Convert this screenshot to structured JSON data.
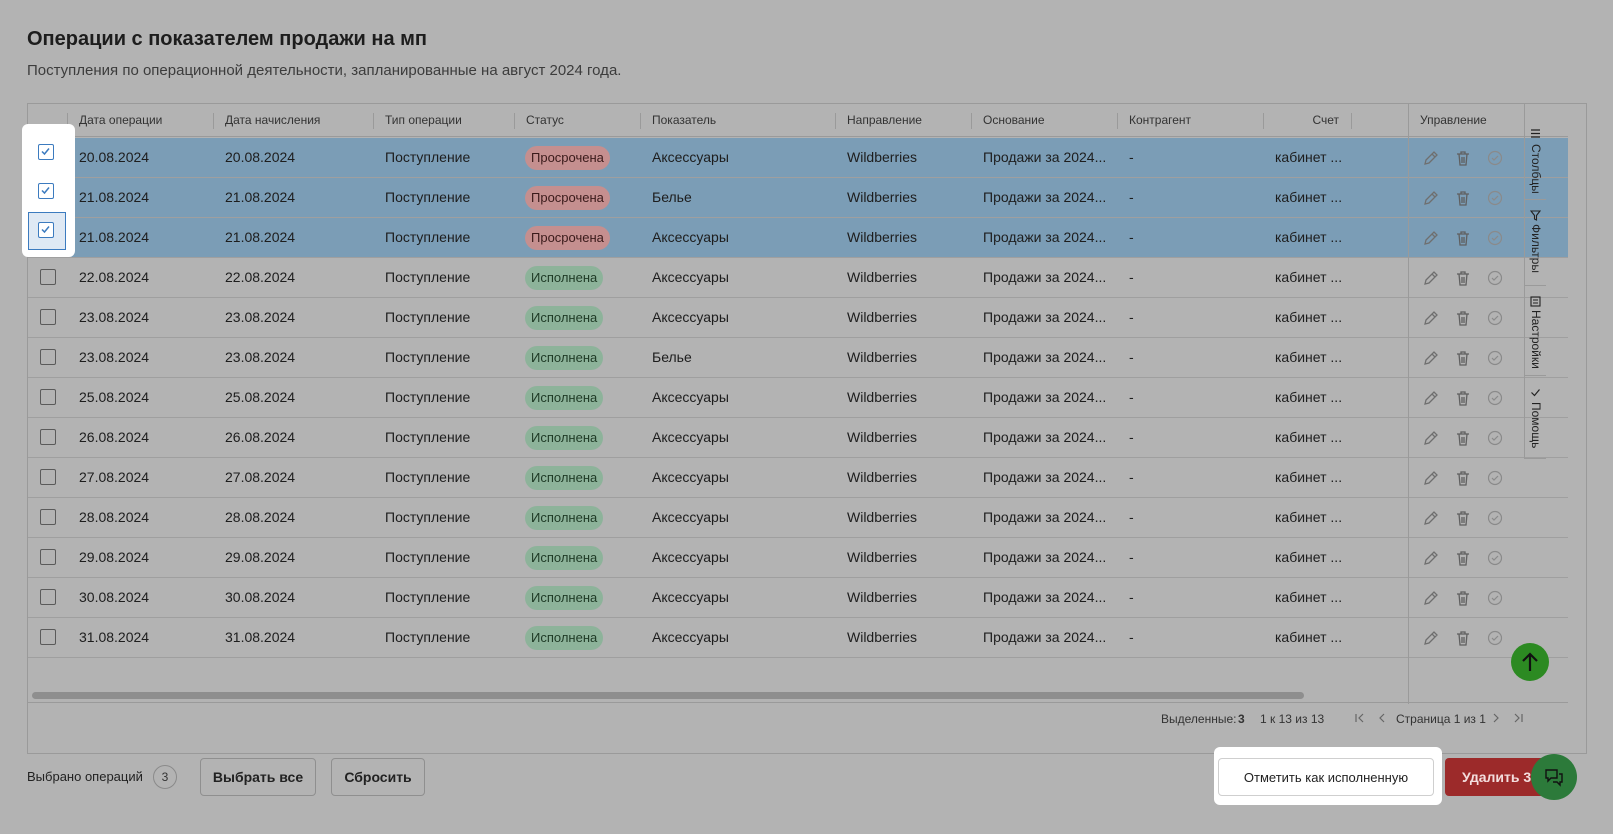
{
  "page": {
    "title": "Операции с показателем продажи на мп",
    "subtitle": "Поступления по операционной деятельности, запланированные на август 2024 года."
  },
  "table": {
    "headers": {
      "op_date": "Дата операции",
      "accrual_date": "Дата начисления",
      "op_type": "Тип операции",
      "status": "Статус",
      "indicator": "Показатель",
      "direction": "Направление",
      "basis": "Основание",
      "counterparty": "Контрагент",
      "account": "Счет",
      "manage": "Управление"
    },
    "rows": [
      {
        "op_date": "20.08.2024",
        "accrual_date": "20.08.2024",
        "op_type": "Поступление",
        "status": "Просрочена",
        "indicator": "Аксессуары",
        "direction": "Wildberries",
        "basis": "Продажи за 2024...",
        "counterparty": "-",
        "account": "кабинет ..."
      },
      {
        "op_date": "21.08.2024",
        "accrual_date": "21.08.2024",
        "op_type": "Поступление",
        "status": "Просрочена",
        "indicator": "Белье",
        "direction": "Wildberries",
        "basis": "Продажи за 2024...",
        "counterparty": "-",
        "account": "кабинет ..."
      },
      {
        "op_date": "21.08.2024",
        "accrual_date": "21.08.2024",
        "op_type": "Поступление",
        "status": "Просрочена",
        "indicator": "Аксессуары",
        "direction": "Wildberries",
        "basis": "Продажи за 2024...",
        "counterparty": "-",
        "account": "кабинет ..."
      },
      {
        "op_date": "22.08.2024",
        "accrual_date": "22.08.2024",
        "op_type": "Поступление",
        "status": "Исполнена",
        "indicator": "Аксессуары",
        "direction": "Wildberries",
        "basis": "Продажи за 2024...",
        "counterparty": "-",
        "account": "кабинет ..."
      },
      {
        "op_date": "23.08.2024",
        "accrual_date": "23.08.2024",
        "op_type": "Поступление",
        "status": "Исполнена",
        "indicator": "Аксессуары",
        "direction": "Wildberries",
        "basis": "Продажи за 2024...",
        "counterparty": "-",
        "account": "кабинет ..."
      },
      {
        "op_date": "23.08.2024",
        "accrual_date": "23.08.2024",
        "op_type": "Поступление",
        "status": "Исполнена",
        "indicator": "Белье",
        "direction": "Wildberries",
        "basis": "Продажи за 2024...",
        "counterparty": "-",
        "account": "кабинет ..."
      },
      {
        "op_date": "25.08.2024",
        "accrual_date": "25.08.2024",
        "op_type": "Поступление",
        "status": "Исполнена",
        "indicator": "Аксессуары",
        "direction": "Wildberries",
        "basis": "Продажи за 2024...",
        "counterparty": "-",
        "account": "кабинет ..."
      },
      {
        "op_date": "26.08.2024",
        "accrual_date": "26.08.2024",
        "op_type": "Поступление",
        "status": "Исполнена",
        "indicator": "Аксессуары",
        "direction": "Wildberries",
        "basis": "Продажи за 2024...",
        "counterparty": "-",
        "account": "кабинет ..."
      },
      {
        "op_date": "27.08.2024",
        "accrual_date": "27.08.2024",
        "op_type": "Поступление",
        "status": "Исполнена",
        "indicator": "Аксессуары",
        "direction": "Wildberries",
        "basis": "Продажи за 2024...",
        "counterparty": "-",
        "account": "кабинет ..."
      },
      {
        "op_date": "28.08.2024",
        "accrual_date": "28.08.2024",
        "op_type": "Поступление",
        "status": "Исполнена",
        "indicator": "Аксессуары",
        "direction": "Wildberries",
        "basis": "Продажи за 2024...",
        "counterparty": "-",
        "account": "кабинет ..."
      },
      {
        "op_date": "29.08.2024",
        "accrual_date": "29.08.2024",
        "op_type": "Поступление",
        "status": "Исполнена",
        "indicator": "Аксессуары",
        "direction": "Wildberries",
        "basis": "Продажи за 2024...",
        "counterparty": "-",
        "account": "кабинет ..."
      },
      {
        "op_date": "30.08.2024",
        "accrual_date": "30.08.2024",
        "op_type": "Поступление",
        "status": "Исполнена",
        "indicator": "Аксессуары",
        "direction": "Wildberries",
        "basis": "Продажи за 2024...",
        "counterparty": "-",
        "account": "кабинет ..."
      },
      {
        "op_date": "31.08.2024",
        "accrual_date": "31.08.2024",
        "op_type": "Поступление",
        "status": "Исполнена",
        "indicator": "Аксессуары",
        "direction": "Wildberries",
        "basis": "Продажи за 2024...",
        "counterparty": "-",
        "account": "кабинет ..."
      }
    ],
    "selected_rows": [
      0,
      1,
      2
    ],
    "row_icons": [
      "pencil-icon",
      "trash-icon",
      "check-circle-icon"
    ]
  },
  "side_panel": {
    "tabs": [
      {
        "label": "Столбцы",
        "icon": "columns-icon"
      },
      {
        "label": "Фильтры",
        "icon": "filter-icon"
      },
      {
        "label": "Настройки",
        "icon": "settings-icon"
      },
      {
        "label": "Помощь",
        "icon": "check-icon"
      }
    ]
  },
  "footer": {
    "selected_label": "Выделенные:",
    "selected_count": "3",
    "range": "1 к 13 из 13",
    "page_info": "Страница 1 из 1"
  },
  "actions": {
    "selected_ops_label": "Выбрано операций",
    "selected_ops_count": "3",
    "select_all": "Выбрать все",
    "reset": "Сбросить",
    "mark_done": "Отметить как исполненную",
    "delete": "Удалить 3"
  },
  "colors": {
    "selected_row": "#7b9db6",
    "overdue_badge": "#c58f8f",
    "done_badge": "#8db39a",
    "delete_button": "#9c2a2a",
    "scroll_up_button": "#2c8a22"
  }
}
